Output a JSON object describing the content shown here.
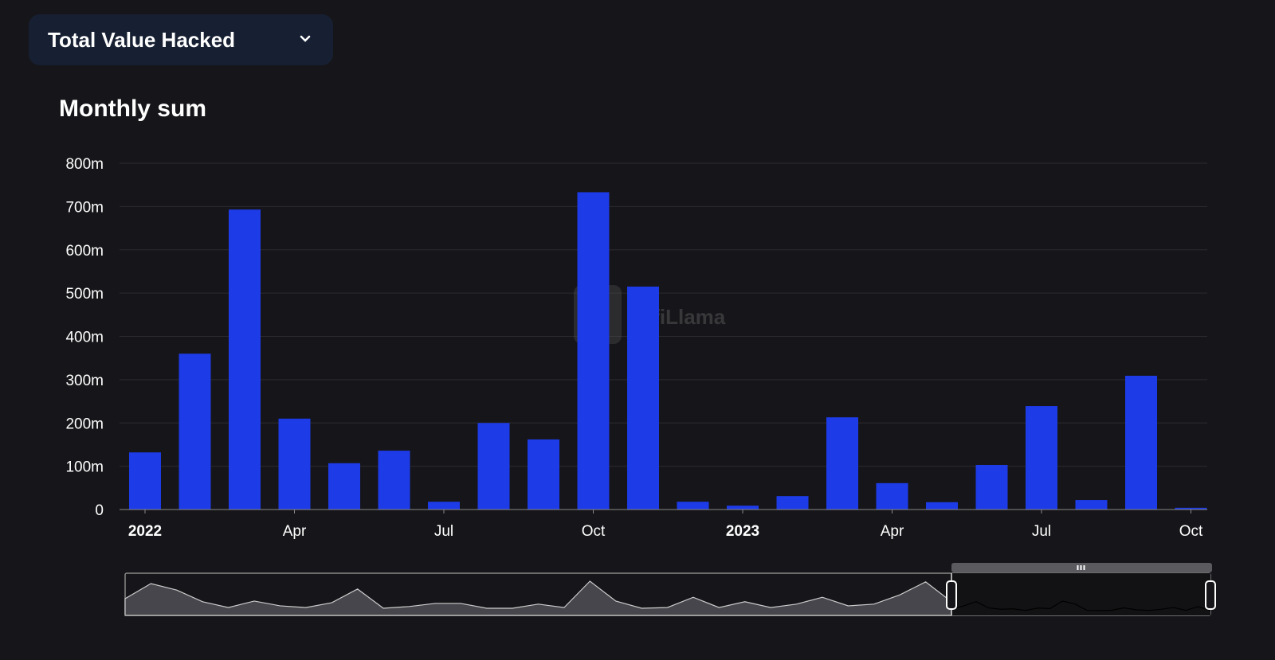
{
  "dropdown": {
    "label": "Total Value Hacked"
  },
  "watermark": "DefiLlama",
  "chart_data": {
    "type": "bar",
    "title": "Monthly sum",
    "xlabel": "",
    "ylabel": "",
    "ylim": [
      0,
      800
    ],
    "y_unit": "m",
    "y_ticks": [
      "0",
      "100m",
      "200m",
      "300m",
      "400m",
      "500m",
      "600m",
      "700m",
      "800m"
    ],
    "categories": [
      "2022-01",
      "2022-02",
      "2022-03",
      "2022-04",
      "2022-05",
      "2022-06",
      "2022-07",
      "2022-08",
      "2022-09",
      "2022-10",
      "2022-11",
      "2022-12",
      "2023-01",
      "2023-02",
      "2023-03",
      "2023-04",
      "2023-05",
      "2023-06",
      "2023-07",
      "2023-08",
      "2023-09",
      "2023-10"
    ],
    "x_ticks": [
      {
        "index": 0,
        "label": "2022",
        "bold": true
      },
      {
        "index": 3,
        "label": "Apr",
        "bold": false
      },
      {
        "index": 6,
        "label": "Jul",
        "bold": false
      },
      {
        "index": 9,
        "label": "Oct",
        "bold": false
      },
      {
        "index": 12,
        "label": "2023",
        "bold": true
      },
      {
        "index": 15,
        "label": "Apr",
        "bold": false
      },
      {
        "index": 18,
        "label": "Jul",
        "bold": false
      },
      {
        "index": 21,
        "label": "Oct",
        "bold": false
      }
    ],
    "values": [
      132,
      360,
      693,
      210,
      107,
      136,
      18,
      200,
      162,
      733,
      515,
      18,
      9,
      31,
      213,
      61,
      17,
      103,
      239,
      22,
      309,
      4
    ],
    "bar_color": "#1d3be6",
    "grid": true,
    "overview_unselected": [
      0.49,
      0.93,
      0.74,
      0.4,
      0.23,
      0.42,
      0.28,
      0.23,
      0.37,
      0.77,
      0.21,
      0.26,
      0.35,
      0.35,
      0.21,
      0.21,
      0.33,
      0.23,
      1.0,
      0.42,
      0.21,
      0.23,
      0.53,
      0.23,
      0.4,
      0.23,
      0.33,
      0.53,
      0.28,
      0.33,
      0.6,
      0.98,
      0.4
    ]
  }
}
